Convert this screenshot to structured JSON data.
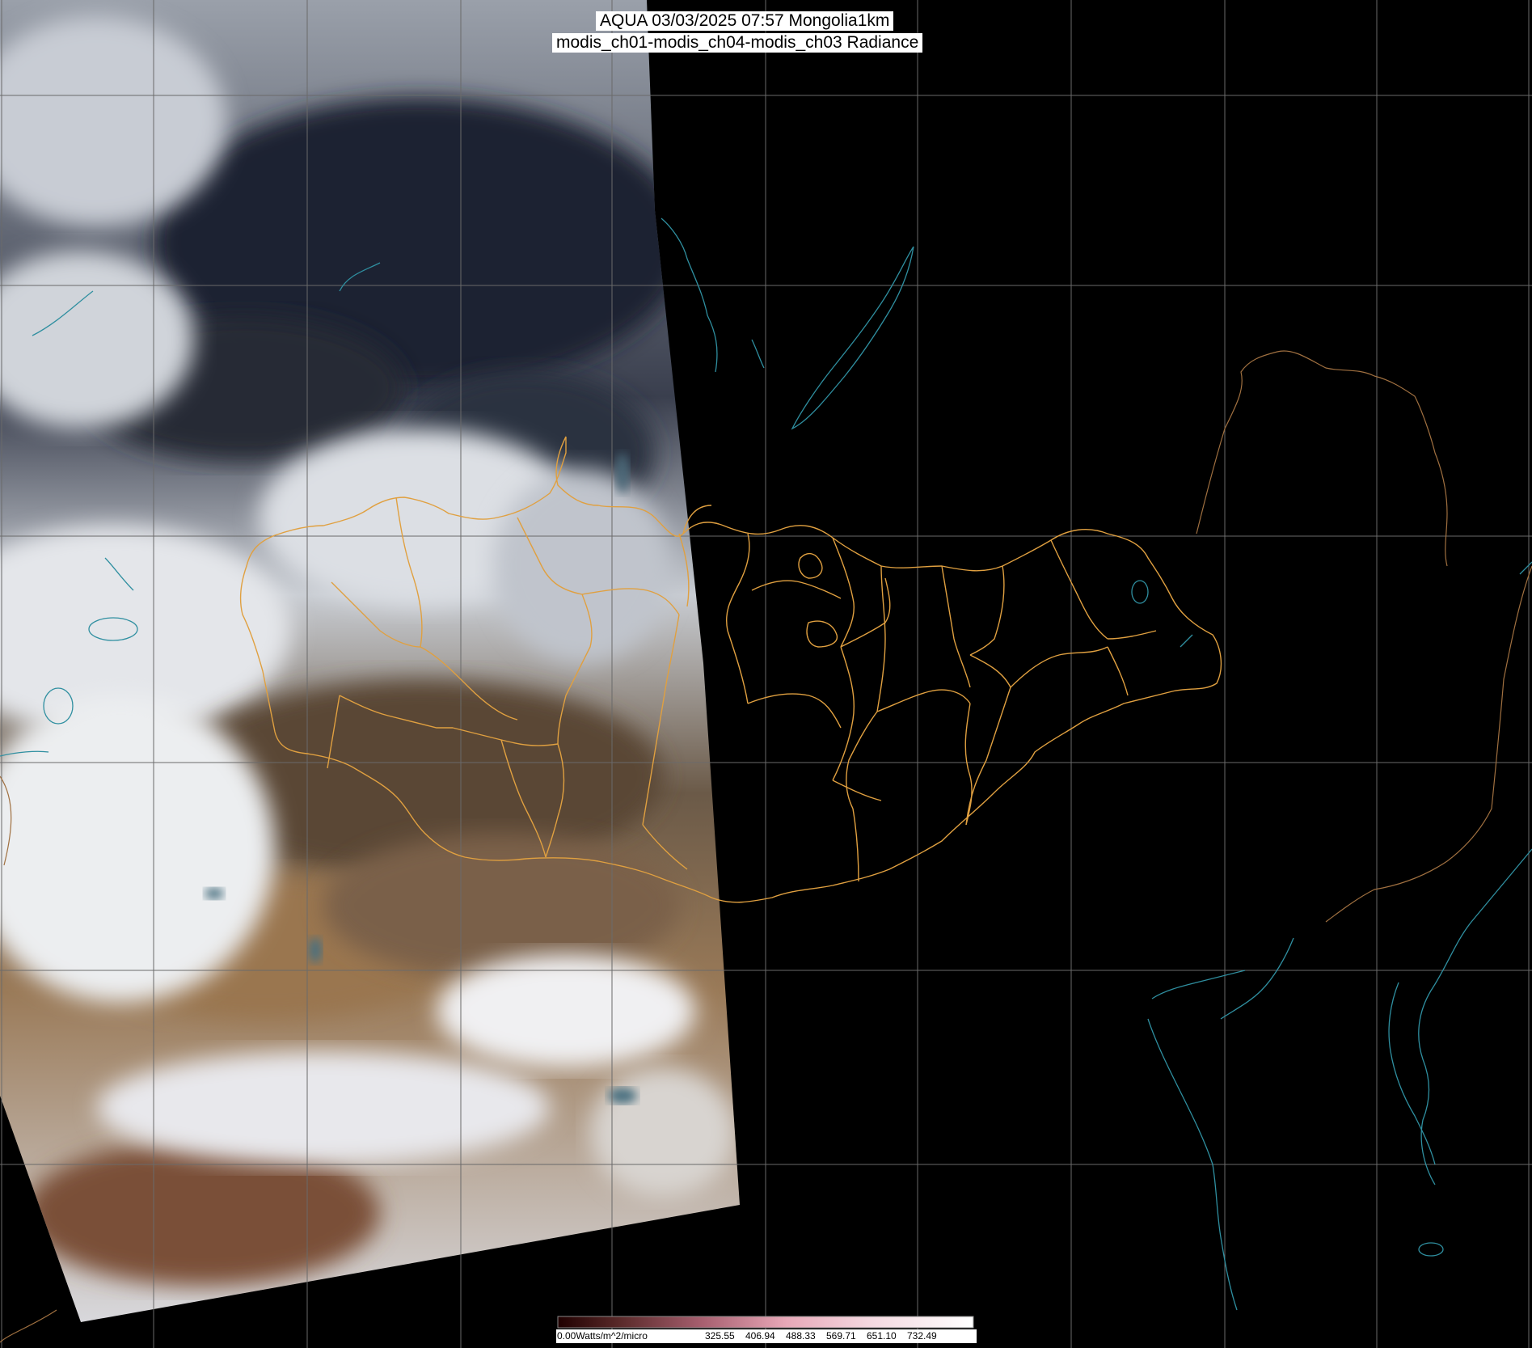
{
  "header": {
    "title_line1": "AQUA 03/03/2025 07:57 Mongolia1km",
    "title_line2": "modis_ch01-modis_ch04-modis_ch03 Radiance"
  },
  "legend": {
    "unit_label": "0.00Watts/m^2/micro",
    "ticks": [
      "325.55",
      "406.94",
      "488.33",
      "569.71",
      "651.10",
      "732.49"
    ],
    "colors": [
      "#200000",
      "#5a2a2a",
      "#a86070",
      "#e8a8b8",
      "#f4d8e0",
      "#ffffff"
    ]
  },
  "map": {
    "colors": {
      "background": "#000000",
      "grid": "#6a6a6a",
      "coastline": "#2f8fa0",
      "admin_border": "#e0a040",
      "country_border": "#a07040",
      "snow": "#e8e8ec",
      "desert": "#8a6a48",
      "forest": "#1e2430"
    }
  }
}
